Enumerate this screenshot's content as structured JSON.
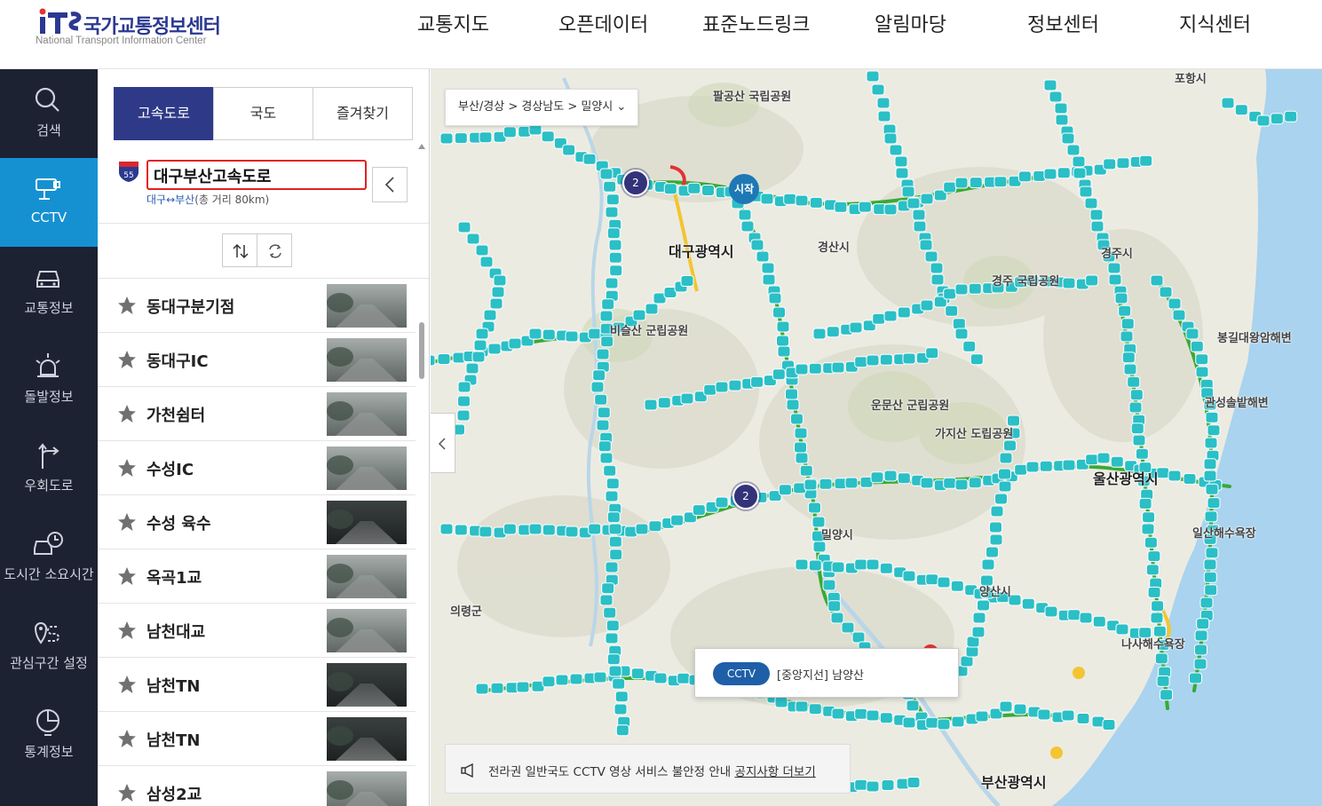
{
  "header": {
    "logo_ko": "국가교통정보센터",
    "logo_en": "National Transport Information Center",
    "nav": [
      "교통지도",
      "오픈데이터",
      "표준노드링크",
      "알림마당",
      "정보센터",
      "지식센터"
    ]
  },
  "sidebar": {
    "items": [
      {
        "label": "검색",
        "icon": "search-icon"
      },
      {
        "label": "CCTV",
        "icon": "cctv-icon",
        "active": true
      },
      {
        "label": "교통정보",
        "icon": "car-icon"
      },
      {
        "label": "돌발정보",
        "icon": "alert-light-icon"
      },
      {
        "label": "우회도로",
        "icon": "detour-icon"
      },
      {
        "label": "도시간 소요시간",
        "icon": "travel-time-icon"
      },
      {
        "label": "관심구간 설정",
        "icon": "location-route-icon"
      },
      {
        "label": "통계정보",
        "icon": "statistics-icon"
      }
    ]
  },
  "panel": {
    "tabs": [
      "고속도로",
      "국도",
      "즐겨찾기"
    ],
    "route": {
      "shield_number": "55",
      "name": "대구부산고속도로",
      "direction": "대구↔부산",
      "distance": "(총 거리 80km)"
    },
    "cameras": [
      {
        "name": "동대구분기점"
      },
      {
        "name": "동대구IC"
      },
      {
        "name": "가천쉼터"
      },
      {
        "name": "수성IC"
      },
      {
        "name": "수성 육수"
      },
      {
        "name": "옥곡1교"
      },
      {
        "name": "남천대교"
      },
      {
        "name": "남천TN"
      },
      {
        "name": "남천TN"
      },
      {
        "name": "삼성2교"
      }
    ]
  },
  "map": {
    "breadcrumb": "부산/경상 > 경상남도 > 밀양시 ⌄",
    "popup": {
      "badge": "CCTV",
      "text": "[중앙지선] 남양산"
    },
    "notice": {
      "text": "전라권 일반국도 CCTV 영상 서비스 불안정 안내",
      "link": "공지사항 더보기"
    },
    "start_label": "시작",
    "clusters": [
      "2",
      "2"
    ],
    "labels": [
      {
        "text": "포항시",
        "big": false
      },
      {
        "text": "팔공산 국립공원",
        "big": false
      },
      {
        "text": "대구광역시",
        "big": true
      },
      {
        "text": "경산시",
        "big": false
      },
      {
        "text": "경주시",
        "big": false
      },
      {
        "text": "경주 국립공원",
        "big": false
      },
      {
        "text": "봉길대왕암해변",
        "big": false
      },
      {
        "text": "비슬산 군립공원",
        "big": false
      },
      {
        "text": "관성솔밭해변",
        "big": false
      },
      {
        "text": "운문산 군립공원",
        "big": false
      },
      {
        "text": "가지산 도립공원",
        "big": false
      },
      {
        "text": "울산광역시",
        "big": true
      },
      {
        "text": "일산해수욕장",
        "big": false
      },
      {
        "text": "밀양시",
        "big": false
      },
      {
        "text": "양산시",
        "big": false
      },
      {
        "text": "의령군",
        "big": false
      },
      {
        "text": "나사해수욕장",
        "big": false
      },
      {
        "text": "부산광역시",
        "big": true
      }
    ]
  },
  "colors": {
    "nav_bg": "#1d2233",
    "nav_active": "#1591d1",
    "tab_active": "#2e3a87",
    "cctv_marker": "#2bbfc6",
    "road_green": "#39a935"
  }
}
